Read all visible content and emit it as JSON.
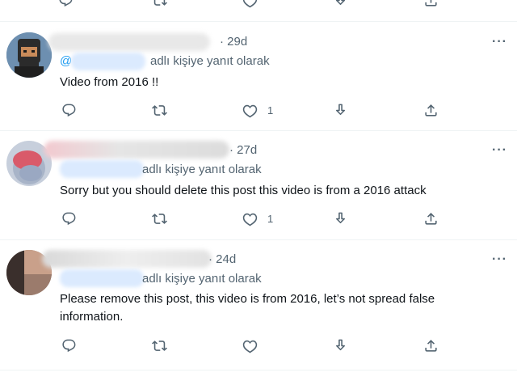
{
  "top_actions": {
    "like_count": ""
  },
  "tweets": [
    {
      "time": "· 29d",
      "reply_prefix": "@",
      "reply_suffix": "adlı kişiye yanıt olarak",
      "text": "Video from 2016 !!",
      "like_count": "1",
      "more": "···"
    },
    {
      "time": "· 27d",
      "reply_prefix": "",
      "reply_suffix": "adlı kişiye yanıt olarak",
      "text": "Sorry but you should delete this post this video is from a 2016 attack",
      "like_count": "1",
      "more": "···"
    },
    {
      "time": "· 24d",
      "reply_prefix": "",
      "reply_suffix": "adlı kişiye yanıt olarak",
      "text": "Please remove this post, this video is from 2016, let’s not spread false information.",
      "like_count": "",
      "more": "···"
    }
  ],
  "icons": [
    "reply-icon",
    "retweet-icon",
    "like-icon",
    "share-down-icon",
    "share-up-icon",
    "more-icon"
  ],
  "colors": {
    "text": "#0f1419",
    "secondary": "#536471",
    "divider": "#eff3f4",
    "mention": "#1d9bf0"
  }
}
